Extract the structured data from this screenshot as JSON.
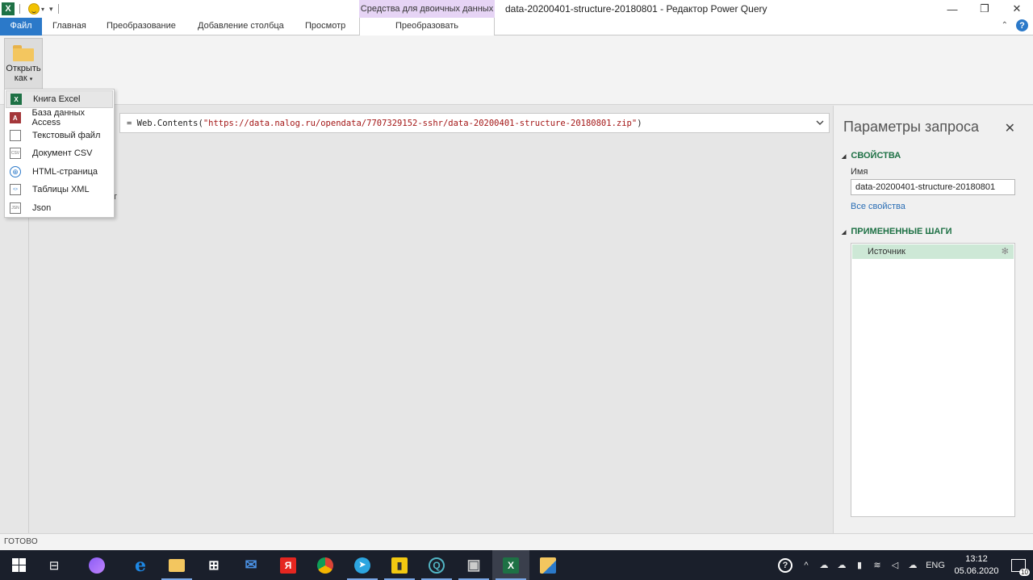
{
  "window": {
    "title": "data-20200401-structure-20180801 - Редактор Power Query",
    "context_tab_group": "Средства для двоичных данных",
    "controls": [
      "—",
      "❐",
      "✕"
    ]
  },
  "qat": {
    "app_icon": "X"
  },
  "ribbon_tabs": {
    "file": "Файл",
    "home": "Главная",
    "transform": "Преобразование",
    "add_column": "Добавление столбца",
    "view": "Просмотр",
    "ctx_transform": "Преобразовать"
  },
  "ribbon": {
    "open_as_line1": "Открыть",
    "open_as_line2": "как",
    "open_as_caret": "▾"
  },
  "open_as_menu": {
    "items": [
      {
        "label": "Книга Excel",
        "icon": "excel-icon",
        "glyph": "X"
      },
      {
        "label": "База данных Access",
        "icon": "access-icon",
        "glyph": "A"
      },
      {
        "label": "Текстовый файл",
        "icon": "text-file-icon",
        "glyph": ""
      },
      {
        "label": "Документ CSV",
        "icon": "csv-icon",
        "glyph": "CSV"
      },
      {
        "label": "HTML-страница",
        "icon": "globe-icon",
        "glyph": "⊕"
      },
      {
        "label": "Таблицы XML",
        "icon": "xml-icon",
        "glyph": "<>"
      },
      {
        "label": "Json",
        "icon": "json-icon",
        "glyph": "JSN"
      }
    ]
  },
  "formula": {
    "eq": "=",
    "func": " Web.Contents(",
    "arg": "\"https://data.nalog.ru/opendata/7707329152-sshr/data-20200401-structure-20180801.zip\"",
    "close": ")"
  },
  "main": {
    "stray_text": "т"
  },
  "query_settings": {
    "title": "Параметры запроса",
    "close": "✕",
    "properties_header": "СВОЙСТВА",
    "name_label": "Имя",
    "name_value": "data-20200401-structure-20180801",
    "all_properties": "Все свойства",
    "steps_header": "ПРИМЕНЕННЫЕ ШАГИ",
    "steps": [
      {
        "label": "Источник",
        "gear": "✻"
      }
    ]
  },
  "status": {
    "text": "ГОТОВО"
  },
  "taskbar": {
    "apps": [
      {
        "name": "start",
        "glyph": ""
      },
      {
        "name": "task-view",
        "glyph": "⊟"
      },
      {
        "name": "alice",
        "glyph": ""
      },
      {
        "name": "edge",
        "glyph": "e"
      },
      {
        "name": "explorer",
        "glyph": ""
      },
      {
        "name": "store",
        "glyph": "⊞"
      },
      {
        "name": "mail",
        "glyph": "✉"
      },
      {
        "name": "yandex",
        "glyph": "Я"
      },
      {
        "name": "chrome",
        "glyph": ""
      },
      {
        "name": "telegram",
        "glyph": "➤"
      },
      {
        "name": "powerbi",
        "glyph": "▮"
      },
      {
        "name": "qlik",
        "glyph": "Q"
      },
      {
        "name": "rdp",
        "glyph": "▣"
      },
      {
        "name": "excel",
        "glyph": "X"
      },
      {
        "name": "files",
        "glyph": ""
      }
    ],
    "tray": {
      "lang": "ENG",
      "time": "13:12",
      "date": "05.06.2020",
      "notifications": "10"
    }
  },
  "colors": {
    "excel_green": "#1e7145",
    "file_tab_blue": "#2b79c9",
    "context_purple": "#e6d4f5",
    "step_selected": "#cde8d6"
  }
}
